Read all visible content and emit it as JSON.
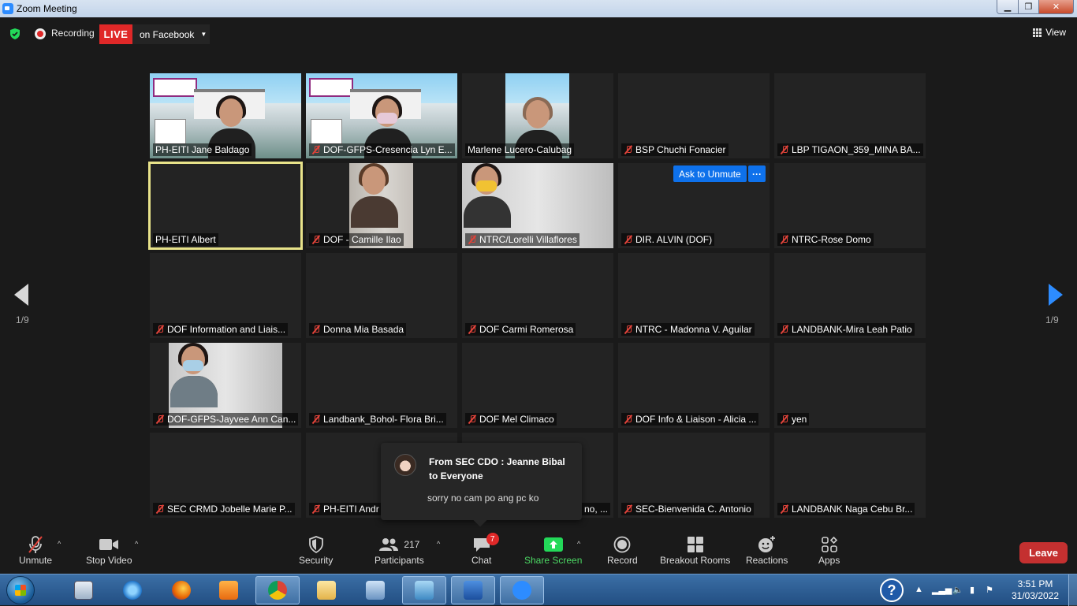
{
  "window": {
    "title": "Zoom Meeting"
  },
  "topbar": {
    "recording_label": "Recording",
    "live_label": "LIVE",
    "live_target": "on Facebook",
    "view_label": "View"
  },
  "pagination": {
    "left": "1/9",
    "right": "1/9"
  },
  "tiles": [
    {
      "name": "PH-EITI Jane Baldago",
      "muted": false,
      "video": "poster"
    },
    {
      "name": "DOF-GFPS-Cresencia Lyn E...",
      "muted": true,
      "video": "poster-mask"
    },
    {
      "name": "Marlene Lucero-Calubag",
      "muted": false,
      "video": "poster-small"
    },
    {
      "name": "BSP Chuchi Fonacier",
      "muted": true,
      "video": "none"
    },
    {
      "name": "LBP TIGAON_359_MINA BA...",
      "muted": true,
      "video": "none"
    },
    {
      "name": "PH-EITI Albert",
      "muted": false,
      "video": "none",
      "active_speaker": true
    },
    {
      "name": "DOF - Camille Ilao",
      "muted": true,
      "video": "office-small"
    },
    {
      "name": "NTRC/Lorelli Villaflores",
      "muted": true,
      "video": "grayroom"
    },
    {
      "name": "DIR. ALVIN (DOF)",
      "muted": true,
      "video": "none",
      "ask_unmute": "Ask to Unmute",
      "more": "···"
    },
    {
      "name": "NTRC-Rose Domo",
      "muted": true,
      "video": "none"
    },
    {
      "name": "DOF Information and Liais...",
      "muted": true,
      "video": "none"
    },
    {
      "name": "Donna Mia Basada",
      "muted": true,
      "video": "none"
    },
    {
      "name": "DOF Carmi Romerosa",
      "muted": true,
      "video": "none"
    },
    {
      "name": "NTRC - Madonna V. Aguilar",
      "muted": true,
      "video": "none"
    },
    {
      "name": "LANDBANK-Mira Leah Patio",
      "muted": true,
      "video": "none"
    },
    {
      "name": "DOF-GFPS-Jayvee Ann Can...",
      "muted": true,
      "video": "two-people"
    },
    {
      "name": "Landbank_Bohol- Flora Bri...",
      "muted": true,
      "video": "none"
    },
    {
      "name": "DOF Mel Climaco",
      "muted": true,
      "video": "none"
    },
    {
      "name": "DOF Info & Liaison - Alicia ...",
      "muted": true,
      "video": "none"
    },
    {
      "name": "yen",
      "muted": true,
      "video": "none"
    },
    {
      "name": "SEC CRMD Jobelle Marie P...",
      "muted": true,
      "video": "none"
    },
    {
      "name": "PH-EITI Andr",
      "muted": true,
      "video": "none"
    },
    {
      "name": "no, ...",
      "muted": false,
      "video": "none",
      "partial": true
    },
    {
      "name": "SEC-Bienvenida C. Antonio",
      "muted": true,
      "video": "none"
    },
    {
      "name": "LANDBANK Naga  Cebu Br...",
      "muted": true,
      "video": "none"
    }
  ],
  "chat_popup": {
    "from_line1": "From SEC CDO : Jeanne Bibal",
    "from_line2": "to Everyone",
    "message": "sorry no cam po ang pc ko"
  },
  "toolbar": {
    "unmute": "Unmute",
    "stop_video": "Stop Video",
    "security": "Security",
    "participants": "Participants",
    "participants_count": "217",
    "chat": "Chat",
    "chat_badge": "7",
    "share_screen": "Share Screen",
    "record": "Record",
    "breakout_rooms": "Breakout Rooms",
    "reactions": "Reactions",
    "apps": "Apps",
    "leave": "Leave"
  },
  "taskbar": {
    "time": "3:51 PM",
    "date": "31/03/2022",
    "help": "?"
  }
}
